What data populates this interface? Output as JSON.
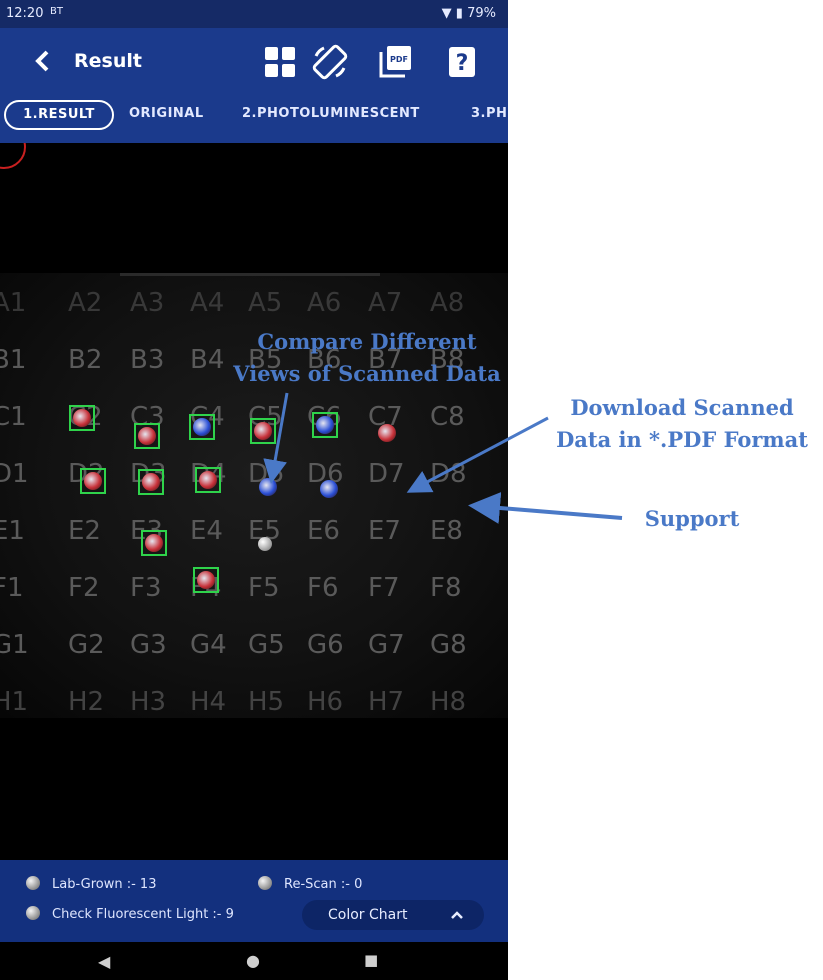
{
  "status_bar": {
    "time": "12:20",
    "network": "BT",
    "battery": "79%"
  },
  "header": {
    "title": "Result",
    "icons": [
      "grid-view-icon",
      "rotate-screen-icon",
      "pdf-download-icon",
      "help-icon"
    ],
    "pdf_label": "PDF",
    "help_label": "?"
  },
  "tabs": [
    "1.RESULT",
    "ORIGINAL",
    "2.PHOTOLUMINESCENT",
    "3.PH"
  ],
  "wells": {
    "row_A": [
      "A1",
      "A2",
      "A3",
      "A4",
      "A5",
      "A6",
      "A7",
      "A8"
    ],
    "row_B": [
      "B1",
      "B2",
      "B3",
      "B4",
      "B5",
      "B6",
      "B7",
      "B8"
    ],
    "row_C": [
      "C1",
      "C2",
      "C3",
      "C4",
      "C5",
      "C6",
      "C7",
      "C8"
    ],
    "row_D": [
      "D1",
      "D2",
      "D3",
      "D4",
      "D5",
      "D6",
      "D7",
      "D8"
    ],
    "row_E": [
      "E1",
      "E2",
      "E3",
      "E4",
      "E5",
      "E6",
      "E7",
      "E8"
    ],
    "row_F": [
      "F1",
      "F2",
      "F3",
      "F4",
      "F5",
      "F6",
      "F7",
      "F8"
    ],
    "row_G": [
      "G1",
      "G2",
      "G3",
      "G4",
      "G5",
      "G6",
      "G7",
      "G8"
    ],
    "row_H": [
      "H1",
      "H2",
      "H3",
      "H4",
      "H5",
      "H6",
      "H7",
      "H8"
    ]
  },
  "legend": {
    "lab_grown": "Lab-Grown :- 13",
    "rescan": "Re-Scan :- 0",
    "check_fluorescent": "Check Fluorescent Light :- 9",
    "color_chart": "Color Chart"
  },
  "nav": {
    "back": "◀",
    "home": "●",
    "recents": "■"
  },
  "annotations": {
    "compare": "Compare Different Views of Scanned Data",
    "download": "Download Scanned Data in *.PDF Format",
    "support": "Support"
  },
  "colors": {
    "header_bg": "#1b3a8c",
    "bottom_bg": "#13307e",
    "annotation": "#4a79c7",
    "mark_border": "#2fd34b",
    "stone_red": "#c8323a",
    "stone_blue": "#2a4fd6"
  }
}
